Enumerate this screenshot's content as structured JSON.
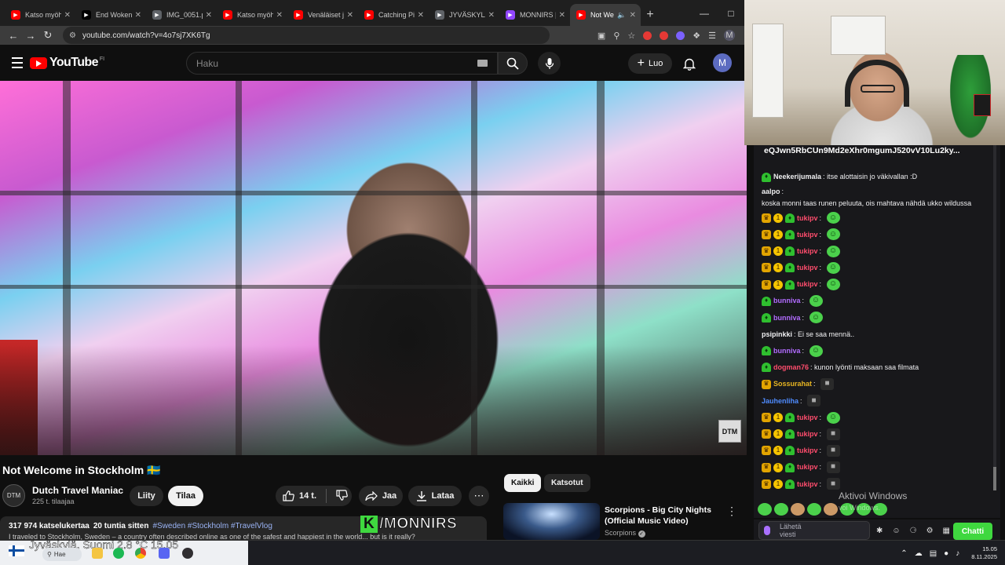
{
  "browser": {
    "tabs": [
      {
        "label": "Katso myöh",
        "color": "#ff0000",
        "active": false
      },
      {
        "label": "End Woken",
        "color": "#000000",
        "active": false
      },
      {
        "label": "IMG_0051.p",
        "color": "#5f6368",
        "active": false
      },
      {
        "label": "Katso myöh",
        "color": "#ff0000",
        "active": false
      },
      {
        "label": "Venäläiset j",
        "color": "#ff0000",
        "active": false
      },
      {
        "label": "Catching Pi",
        "color": "#ff0000",
        "active": false
      },
      {
        "label": "JYVÄSKYLÄ",
        "color": "#5f6368",
        "active": false
      },
      {
        "label": "MONNIRS |",
        "color": "#9146ff",
        "active": false
      },
      {
        "label": "Not We",
        "color": "#ff0000",
        "active": true
      }
    ],
    "url": "youtube.com/watch?v=4o7sj7XK6Tg"
  },
  "youtube": {
    "logo_text": "YouTube",
    "country_code": "FI",
    "search_placeholder": "Haku",
    "create_label": "Luo",
    "avatar_letter": "M"
  },
  "video": {
    "title": "Not Welcome in Stockholm 🇸🇪",
    "channel_name": "Dutch Travel Maniac",
    "subscribers": "225 t. tilaajaa",
    "join_label": "Liity",
    "subscribe_label": "Tilaa",
    "likes": "14 t.",
    "share_label": "Jaa",
    "download_label": "Lataa",
    "views": "317 974 katselukertaa",
    "age": "20 tuntia sitten",
    "hashtags": "#Sweden #Stockholm #TravelVlog",
    "description": "I traveled to Stockholm, Sweden – a country often described online as one of the safest and happiest in the world... but is it really?",
    "overlay_logo": "/MONNIRS"
  },
  "recommendations": {
    "chips": [
      "Kaikki",
      "Katsotut"
    ],
    "first": {
      "title": "Scorpions - Big City Nights (Official Music Video)",
      "channel": "Scorpions"
    }
  },
  "chat": {
    "pinned": "eQJwn5RbCUn9Md2eXhr0mgumJ520vV10Lu2ky...",
    "messages": [
      {
        "badges": [
          "leaf"
        ],
        "user": "Neekerijumala",
        "color": "#efeff1",
        "text": "itse alottaisin jo väkivallan :D",
        "emotes": 0
      },
      {
        "badges": [],
        "user": "aalpo",
        "color": "#efeff1",
        "text": "koska monni taas runen peluuta, ois mahtava nähdä ukko wildussa",
        "emotes": 0
      },
      {
        "badges": [
          "crown",
          "sub",
          "leaf"
        ],
        "user": "tukipv",
        "color": "#ff4d6d",
        "text": "",
        "emotes": 1
      },
      {
        "badges": [
          "crown",
          "sub",
          "leaf"
        ],
        "user": "tukipv",
        "color": "#ff4d6d",
        "text": "",
        "emotes": 1
      },
      {
        "badges": [
          "crown",
          "sub",
          "leaf"
        ],
        "user": "tukipv",
        "color": "#ff4d6d",
        "text": "",
        "emotes": 1
      },
      {
        "badges": [
          "crown",
          "sub",
          "leaf"
        ],
        "user": "tukipv",
        "color": "#ff4d6d",
        "text": "",
        "emotes": 1
      },
      {
        "badges": [
          "crown",
          "sub",
          "leaf"
        ],
        "user": "tukipv",
        "color": "#ff4d6d",
        "text": "",
        "emotes": 1
      },
      {
        "badges": [
          "leaf"
        ],
        "user": "bunniva",
        "color": "#b26cff",
        "text": "",
        "emotes": 1
      },
      {
        "badges": [
          "leaf"
        ],
        "user": "bunniva",
        "color": "#b26cff",
        "text": "",
        "emotes": 1
      },
      {
        "badges": [],
        "user": "psipinkki",
        "color": "#efeff1",
        "text": "Ei se saa mennä..",
        "emotes": 0
      },
      {
        "badges": [
          "leaf"
        ],
        "user": "bunniva",
        "color": "#b26cff",
        "text": "",
        "emotes": 1
      },
      {
        "badges": [
          "leaf"
        ],
        "user": "dogman76",
        "color": "#ff4d6d",
        "text": "kunon lyönti maksaan saa filmata",
        "emotes": 0
      },
      {
        "badges": [
          "crown"
        ],
        "user": "Sossurahat",
        "color": "#e6b422",
        "text": "",
        "emotes": 2
      },
      {
        "badges": [],
        "user": "Jauhenliha",
        "color": "#4f8cff",
        "text": "",
        "emotes": 2
      },
      {
        "badges": [
          "crown",
          "sub",
          "leaf"
        ],
        "user": "tukipv",
        "color": "#ff4d6d",
        "text": "",
        "emotes": 1
      },
      {
        "badges": [
          "crown",
          "sub",
          "leaf"
        ],
        "user": "tukipv",
        "color": "#ff4d6d",
        "text": "",
        "emotes": 2
      },
      {
        "badges": [
          "crown",
          "sub",
          "leaf"
        ],
        "user": "tukipv",
        "color": "#ff4d6d",
        "text": "",
        "emotes": 2
      },
      {
        "badges": [
          "crown",
          "sub",
          "leaf"
        ],
        "user": "tukipv",
        "color": "#ff4d6d",
        "text": "",
        "emotes": 2
      },
      {
        "badges": [
          "crown",
          "sub",
          "leaf"
        ],
        "user": "tukipv",
        "color": "#ff4d6d",
        "text": "",
        "emotes": 2
      }
    ],
    "input_placeholder": "Lähetä viesti",
    "send_label": "Chatti"
  },
  "windows_overlay": {
    "activate_title": "Aktivoi Windows",
    "activate_sub": "voi Windows."
  },
  "taskbar": {
    "weather_text": "Jyväskylä, Suomi   2.8 °C   15.05",
    "search_label": "Hae",
    "time": "15.05",
    "date": "8.11.2025"
  }
}
